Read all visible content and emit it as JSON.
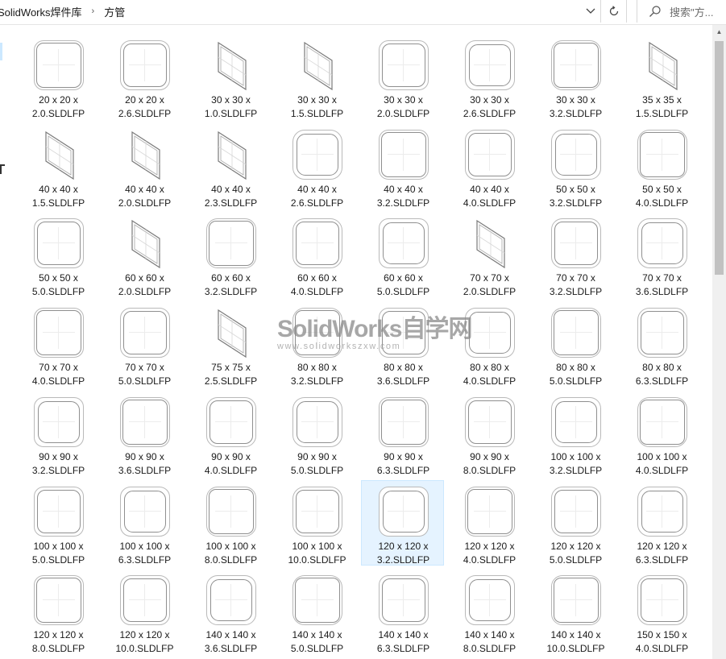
{
  "address_bar": {
    "breadcrumbs": [
      "SolidWorks焊件库",
      "方管"
    ],
    "separator": "›",
    "dropdown_glyph": "⌄",
    "refresh_glyph": "↻"
  },
  "search": {
    "placeholder": "搜索\"方...",
    "icon": "search-icon"
  },
  "files": [
    {
      "line1": "20 x 20 x",
      "line2": "2.0.SLDLFP",
      "thumb": "square"
    },
    {
      "line1": "20 x 20 x",
      "line2": "2.6.SLDLFP",
      "thumb": "square"
    },
    {
      "line1": "30 x 30 x",
      "line2": "1.0.SLDLFP",
      "thumb": "skew"
    },
    {
      "line1": "30 x 30 x",
      "line2": "1.5.SLDLFP",
      "thumb": "skew"
    },
    {
      "line1": "30 x 30 x",
      "line2": "2.0.SLDLFP",
      "thumb": "square"
    },
    {
      "line1": "30 x 30 x",
      "line2": "2.6.SLDLFP",
      "thumb": "square"
    },
    {
      "line1": "30 x 30 x",
      "line2": "3.2.SLDLFP",
      "thumb": "square"
    },
    {
      "line1": "35 x 35 x",
      "line2": "1.5.SLDLFP",
      "thumb": "skew"
    },
    {
      "line1": "40 x 40 x",
      "line2": "1.5.SLDLFP",
      "thumb": "skew"
    },
    {
      "line1": "40 x 40 x",
      "line2": "2.0.SLDLFP",
      "thumb": "skew"
    },
    {
      "line1": "40 x 40 x",
      "line2": "2.3.SLDLFP",
      "thumb": "skew"
    },
    {
      "line1": "40 x 40 x",
      "line2": "2.6.SLDLFP",
      "thumb": "square"
    },
    {
      "line1": "40 x 40 x",
      "line2": "3.2.SLDLFP",
      "thumb": "square"
    },
    {
      "line1": "40 x 40 x",
      "line2": "4.0.SLDLFP",
      "thumb": "square"
    },
    {
      "line1": "50 x 50 x",
      "line2": "3.2.SLDLFP",
      "thumb": "square"
    },
    {
      "line1": "50 x 50 x",
      "line2": "4.0.SLDLFP",
      "thumb": "square"
    },
    {
      "line1": "50 x 50 x",
      "line2": "5.0.SLDLFP",
      "thumb": "square"
    },
    {
      "line1": "60 x 60 x",
      "line2": "2.0.SLDLFP",
      "thumb": "skew"
    },
    {
      "line1": "60 x 60 x",
      "line2": "3.2.SLDLFP",
      "thumb": "square"
    },
    {
      "line1": "60 x 60 x",
      "line2": "4.0.SLDLFP",
      "thumb": "square"
    },
    {
      "line1": "60 x 60 x",
      "line2": "5.0.SLDLFP",
      "thumb": "square"
    },
    {
      "line1": "70 x 70 x",
      "line2": "2.0.SLDLFP",
      "thumb": "skew"
    },
    {
      "line1": "70 x 70 x",
      "line2": "3.2.SLDLFP",
      "thumb": "square"
    },
    {
      "line1": "70 x 70 x",
      "line2": "3.6.SLDLFP",
      "thumb": "square"
    },
    {
      "line1": "70 x 70 x",
      "line2": "4.0.SLDLFP",
      "thumb": "square"
    },
    {
      "line1": "70 x 70 x",
      "line2": "5.0.SLDLFP",
      "thumb": "square"
    },
    {
      "line1": "75 x 75 x",
      "line2": "2.5.SLDLFP",
      "thumb": "skew"
    },
    {
      "line1": "80 x 80 x",
      "line2": "3.2.SLDLFP",
      "thumb": "square"
    },
    {
      "line1": "80 x 80 x",
      "line2": "3.6.SLDLFP",
      "thumb": "square"
    },
    {
      "line1": "80 x 80 x",
      "line2": "4.0.SLDLFP",
      "thumb": "square"
    },
    {
      "line1": "80 x 80 x",
      "line2": "5.0.SLDLFP",
      "thumb": "square"
    },
    {
      "line1": "80 x 80 x",
      "line2": "6.3.SLDLFP",
      "thumb": "square"
    },
    {
      "line1": "90 x 90 x",
      "line2": "3.2.SLDLFP",
      "thumb": "square"
    },
    {
      "line1": "90 x 90 x",
      "line2": "3.6.SLDLFP",
      "thumb": "square"
    },
    {
      "line1": "90 x 90 x",
      "line2": "4.0.SLDLFP",
      "thumb": "square"
    },
    {
      "line1": "90 x 90 x",
      "line2": "5.0.SLDLFP",
      "thumb": "square"
    },
    {
      "line1": "90 x 90 x",
      "line2": "6.3.SLDLFP",
      "thumb": "square"
    },
    {
      "line1": "90 x 90 x",
      "line2": "8.0.SLDLFP",
      "thumb": "square"
    },
    {
      "line1": "100 x 100 x",
      "line2": "3.2.SLDLFP",
      "thumb": "square"
    },
    {
      "line1": "100 x 100 x",
      "line2": "4.0.SLDLFP",
      "thumb": "square"
    },
    {
      "line1": "100 x 100 x",
      "line2": "5.0.SLDLFP",
      "thumb": "square"
    },
    {
      "line1": "100 x 100 x",
      "line2": "6.3.SLDLFP",
      "thumb": "square"
    },
    {
      "line1": "100 x 100 x",
      "line2": "8.0.SLDLFP",
      "thumb": "square"
    },
    {
      "line1": "100 x 100 x",
      "line2": "10.0.SLDLFP",
      "thumb": "square"
    },
    {
      "line1": "120 x 120 x",
      "line2": "3.2.SLDLFP",
      "thumb": "square",
      "selected": true
    },
    {
      "line1": "120 x 120 x",
      "line2": "4.0.SLDLFP",
      "thumb": "square"
    },
    {
      "line1": "120 x 120 x",
      "line2": "5.0.SLDLFP",
      "thumb": "square"
    },
    {
      "line1": "120 x 120 x",
      "line2": "6.3.SLDLFP",
      "thumb": "square"
    },
    {
      "line1": "120 x 120 x",
      "line2": "8.0.SLDLFP",
      "thumb": "square"
    },
    {
      "line1": "120 x 120 x",
      "line2": "10.0.SLDLFP",
      "thumb": "square"
    },
    {
      "line1": "140 x 140 x",
      "line2": "3.6.SLDLFP",
      "thumb": "square"
    },
    {
      "line1": "140 x 140 x",
      "line2": "5.0.SLDLFP",
      "thumb": "square"
    },
    {
      "line1": "140 x 140 x",
      "line2": "6.3.SLDLFP",
      "thumb": "square"
    },
    {
      "line1": "140 x 140 x",
      "line2": "8.0.SLDLFP",
      "thumb": "square"
    },
    {
      "line1": "140 x 140 x",
      "line2": "10.0.SLDLFP",
      "thumb": "square"
    },
    {
      "line1": "150 x 150 x",
      "line2": "4.0.SLDLFP",
      "thumb": "square"
    }
  ],
  "watermark": {
    "brand": "SolidWorks自学网",
    "url": "www.solidworkszxw.com"
  },
  "colors": {
    "selected_bg": "#e5f3ff",
    "selected_border": "#cce8ff"
  }
}
